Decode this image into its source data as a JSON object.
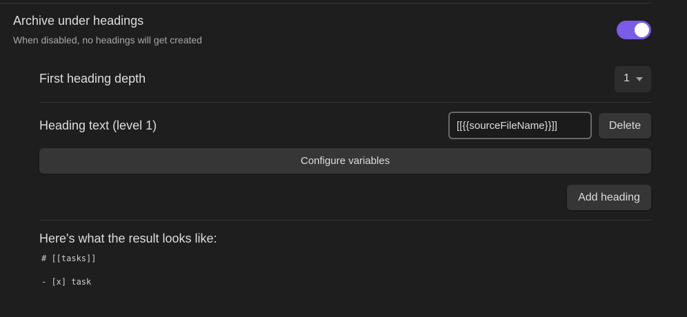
{
  "archive_setting": {
    "title": "Archive under headings",
    "description": "When disabled, no headings will get created",
    "toggle_on": true,
    "accent_color": "#7b5ce6"
  },
  "depth_setting": {
    "label": "First heading depth",
    "selected_value": "1",
    "icon": "chevron-down-icon"
  },
  "heading_setting": {
    "label": "Heading text (level 1)",
    "input_value": "[[{{sourceFileName}}]]",
    "delete_label": "Delete"
  },
  "configure_label": "Configure variables",
  "add_heading_label": "Add heading",
  "result": {
    "label": "Here's what the result looks like:",
    "lines": [
      "# [[tasks]]",
      "",
      "- [x] task"
    ]
  }
}
